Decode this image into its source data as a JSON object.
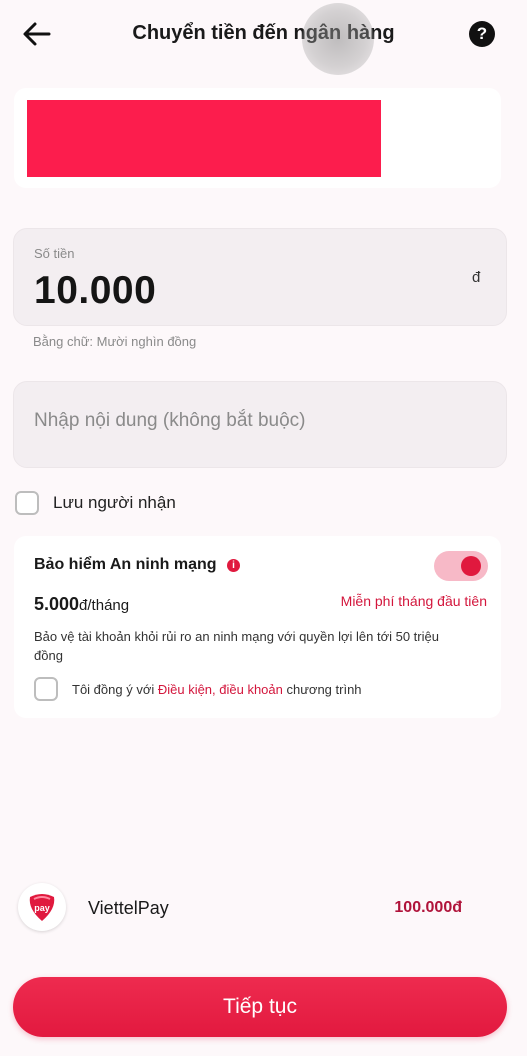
{
  "header": {
    "title": "Chuyển tiền đến ngân hàng",
    "back_icon": "arrow-left-icon",
    "help_icon": "question-mark-icon",
    "help_symbol": "?"
  },
  "amount": {
    "label": "Số tiền",
    "value": "10.000",
    "currency": "đ",
    "in_words": "Bằng chữ: Mười nghìn đồng"
  },
  "content": {
    "placeholder": "Nhập nội dung (không bắt buộc)",
    "value": ""
  },
  "save_recipient": {
    "label": "Lưu người nhận",
    "checked": false
  },
  "insurance": {
    "title": "Bảo hiểm An ninh mạng",
    "info_symbol": "i",
    "toggle_on": true,
    "price": "5.000",
    "price_unit": "đ/tháng",
    "free_note": "Miễn phí tháng đầu tiên",
    "description": "Bảo vệ tài khoản khỏi rủi ro an ninh mạng với quyền lợi lên tới 50 triệu đồng",
    "agree_prefix": "Tôi đồng ý với ",
    "agree_link": "Điều kiện, điều khoản",
    "agree_suffix": " chương trình",
    "agree_checked": false
  },
  "payment_source": {
    "name": "ViettelPay",
    "balance": "100.000đ",
    "logo_text": "pay"
  },
  "actions": {
    "continue_label": "Tiếp tục"
  },
  "colors": {
    "accent": "#e0193e",
    "redaction": "#fc1d4d",
    "toggle_track": "#f7b9c7"
  }
}
